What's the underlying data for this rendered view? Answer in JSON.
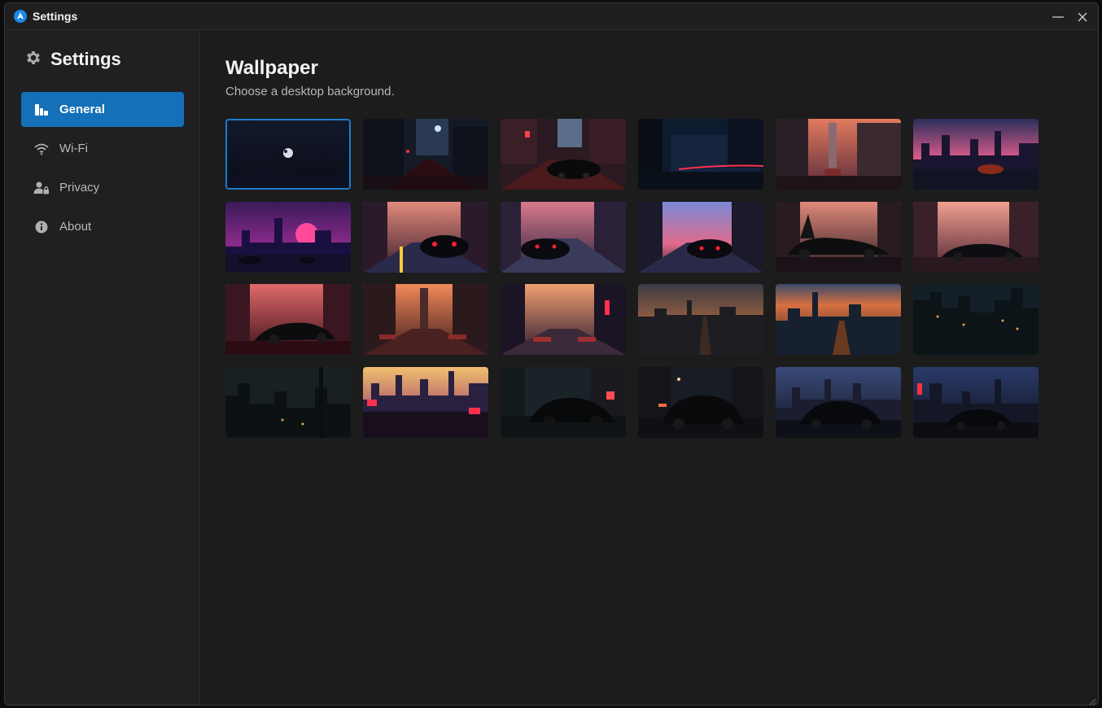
{
  "window": {
    "title": "Settings",
    "controls": {
      "minimize": "minimize-icon",
      "close": "close-icon"
    }
  },
  "sidebar": {
    "header": {
      "label": "Settings",
      "icon": "gear-icon"
    },
    "items": [
      {
        "label": "General",
        "icon": "general-icon",
        "active": true
      },
      {
        "label": "Wi-Fi",
        "icon": "wifi-icon",
        "active": false
      },
      {
        "label": "Privacy",
        "icon": "privacy-icon",
        "active": false
      },
      {
        "label": "About",
        "icon": "info-icon",
        "active": false
      }
    ]
  },
  "main": {
    "title": "Wallpaper",
    "subtitle": "Choose a desktop background.",
    "selected_index": 0
  },
  "colors": {
    "accent": "#1470b8",
    "selection_outline": "#1e7ad0",
    "window_bg": "#1c1c1d",
    "sidebar_bg": "#202022"
  }
}
